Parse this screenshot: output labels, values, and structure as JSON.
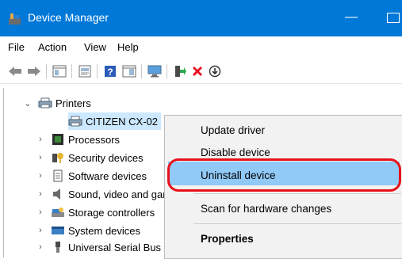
{
  "window": {
    "title": "Device Manager",
    "minimize_glyph": "—"
  },
  "menu": {
    "items": [
      "File",
      "Action",
      "View",
      "Help"
    ]
  },
  "toolbar": {
    "icons": [
      "back-arrow-icon",
      "forward-arrow-icon",
      "show-hide-tree-icon",
      "properties-icon",
      "help-icon",
      "view-icon",
      "monitor-icon",
      "update-driver-icon",
      "uninstall-icon",
      "download-icon"
    ]
  },
  "tree": {
    "printers": "Printers",
    "citizen": "CITIZEN CX-02",
    "processors": "Processors",
    "security": "Security devices",
    "software": "Software devices",
    "sound": "Sound, video and game controllers",
    "storage": "Storage controllers",
    "system": "System devices",
    "usb": "Universal Serial Bus controllers"
  },
  "context_menu": {
    "update": "Update driver",
    "disable": "Disable device",
    "uninstall": "Uninstall device",
    "scan": "Scan for hardware changes",
    "properties": "Properties"
  },
  "colors": {
    "titlebar": "#0078d7",
    "highlight": "#91c9f7",
    "annotation": "#e8111a",
    "delete_x": "#e81123"
  }
}
